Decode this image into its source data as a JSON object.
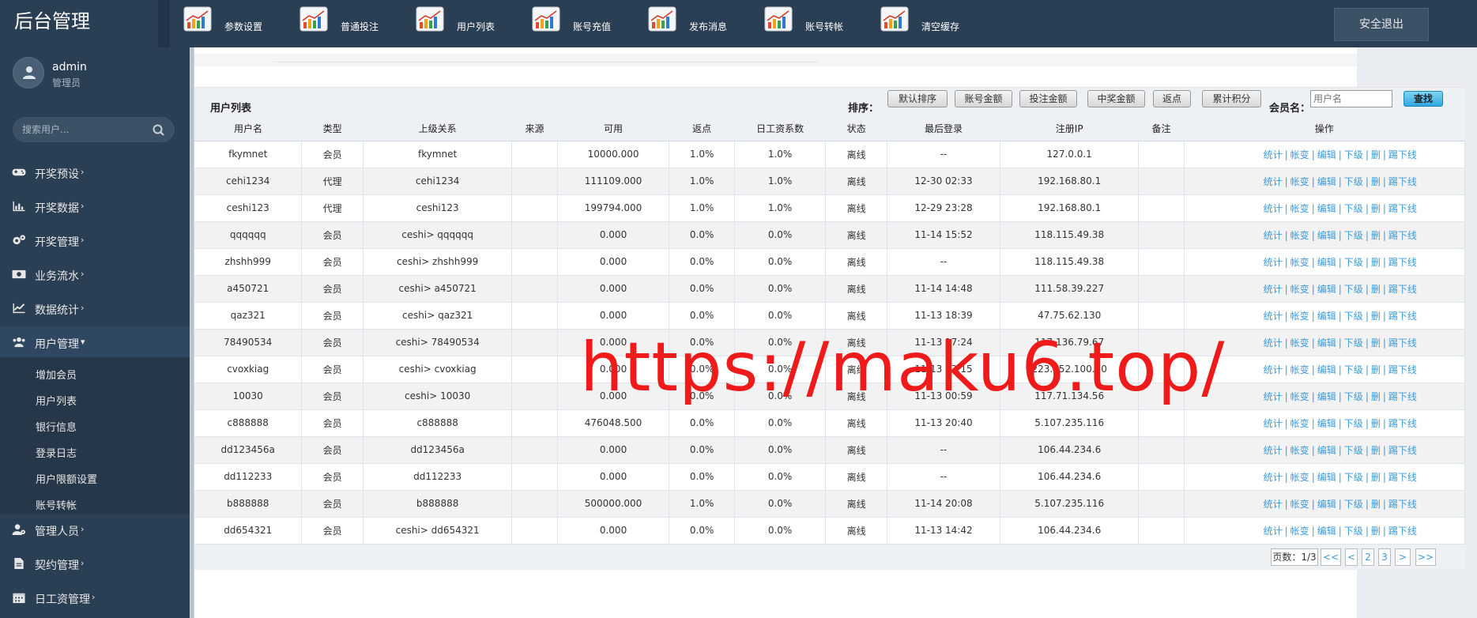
{
  "app": {
    "brand": "后台管理",
    "logout_label": "安全退出"
  },
  "topnav": [
    {
      "label": "参数设置",
      "icon": "chart-icon"
    },
    {
      "label": "普通投注",
      "icon": "chart-icon"
    },
    {
      "label": "用户列表",
      "icon": "chart-icon"
    },
    {
      "label": "账号充值",
      "icon": "chart-icon"
    },
    {
      "label": "发布消息",
      "icon": "chart-icon"
    },
    {
      "label": "账号转帐",
      "icon": "chart-icon"
    },
    {
      "label": "清空缓存",
      "icon": "chart-icon"
    }
  ],
  "user": {
    "name": "admin",
    "role": "管理员"
  },
  "sidebar": {
    "search_placeholder": "搜索用户...",
    "items": [
      {
        "label": "开奖预设",
        "icon": "gamepad-icon"
      },
      {
        "label": "开奖数据",
        "icon": "bar-chart-icon"
      },
      {
        "label": "开奖管理",
        "icon": "gears-icon"
      },
      {
        "label": "业务流水",
        "icon": "money-icon"
      },
      {
        "label": "数据统计",
        "icon": "line-chart-icon"
      },
      {
        "label": "用户管理",
        "icon": "users-icon"
      },
      {
        "label": "管理人员",
        "icon": "user-gear-icon"
      },
      {
        "label": "契约管理",
        "icon": "document-icon"
      },
      {
        "label": "日工资管理",
        "icon": "calendar-icon"
      }
    ],
    "submenu": [
      "增加会员",
      "用户列表",
      "银行信息",
      "登录日志",
      "用户限额设置",
      "账号转帐"
    ]
  },
  "panel": {
    "title": "用户列表",
    "sort_label": "排序：",
    "sort_buttons": [
      "默认排序",
      "账号金额",
      "投注金额",
      "中奖金额",
      "返点",
      "累计积分"
    ],
    "member_label": "会员名：",
    "member_placeholder": "用户名",
    "query_label": "查找"
  },
  "table": {
    "headers": [
      "用户名",
      "类型",
      "上级关系",
      "来源",
      "可用",
      "返点",
      "日工资系数",
      "状态",
      "最后登录",
      "注册IP",
      "备注",
      "操作"
    ],
    "actions": [
      "统计",
      "帐变",
      "编辑",
      "下级",
      "删",
      "踢下线"
    ],
    "rows": [
      [
        "fkymnet",
        "会员",
        "fkymnet",
        "",
        "10000.000",
        "1.0%",
        "1.0%",
        "离线",
        "--",
        "127.0.0.1",
        ""
      ],
      [
        "cehi1234",
        "代理",
        "cehi1234",
        "",
        "111109.000",
        "1.0%",
        "1.0%",
        "离线",
        "12-30 02:33",
        "192.168.80.1",
        ""
      ],
      [
        "ceshi123",
        "代理",
        "ceshi123",
        "",
        "199794.000",
        "1.0%",
        "1.0%",
        "离线",
        "12-29 23:28",
        "192.168.80.1",
        ""
      ],
      [
        "qqqqqq",
        "会员",
        "ceshi> qqqqqq",
        "",
        "0.000",
        "0.0%",
        "0.0%",
        "离线",
        "11-14 15:52",
        "118.115.49.38",
        ""
      ],
      [
        "zhshh999",
        "会员",
        "ceshi> zhshh999",
        "",
        "0.000",
        "0.0%",
        "0.0%",
        "离线",
        "--",
        "118.115.49.38",
        ""
      ],
      [
        "a450721",
        "会员",
        "ceshi> a450721",
        "",
        "0.000",
        "0.0%",
        "0.0%",
        "离线",
        "11-14 14:48",
        "111.58.39.227",
        ""
      ],
      [
        "qaz321",
        "会员",
        "ceshi> qaz321",
        "",
        "0.000",
        "0.0%",
        "0.0%",
        "离线",
        "11-13 18:39",
        "47.75.62.130",
        ""
      ],
      [
        "78490534",
        "会员",
        "ceshi> 78490534",
        "",
        "0.000",
        "0.0%",
        "0.0%",
        "离线",
        "11-13 17:24",
        "117.136.79.67",
        ""
      ],
      [
        "cvoxkiag",
        "会员",
        "ceshi> cvoxkiag",
        "",
        "0.000",
        "0.0%",
        "0.0%",
        "离线",
        "11-13 13:15",
        "223.152.100.50",
        ""
      ],
      [
        "10030",
        "会员",
        "ceshi> 10030",
        "",
        "0.000",
        "0.0%",
        "0.0%",
        "离线",
        "11-13 00:59",
        "117.71.134.56",
        ""
      ],
      [
        "c888888",
        "会员",
        "c888888",
        "",
        "476048.500",
        "0.0%",
        "0.0%",
        "离线",
        "11-13 20:40",
        "5.107.235.116",
        ""
      ],
      [
        "dd123456a",
        "会员",
        "dd123456a",
        "",
        "0.000",
        "0.0%",
        "0.0%",
        "离线",
        "--",
        "106.44.234.6",
        ""
      ],
      [
        "dd112233",
        "会员",
        "dd112233",
        "",
        "0.000",
        "0.0%",
        "0.0%",
        "离线",
        "--",
        "106.44.234.6",
        ""
      ],
      [
        "b888888",
        "会员",
        "b888888",
        "",
        "500000.000",
        "1.0%",
        "0.0%",
        "离线",
        "11-14 20:08",
        "5.107.235.116",
        ""
      ],
      [
        "dd654321",
        "会员",
        "ceshi> dd654321",
        "",
        "0.000",
        "0.0%",
        "0.0%",
        "离线",
        "11-13 14:42",
        "106.44.234.6",
        ""
      ]
    ]
  },
  "pagination": {
    "info": "页数：1/3",
    "buttons": [
      "<<",
      "<",
      "2",
      "3",
      ">",
      ">>"
    ]
  },
  "watermark": "https://maku6.top/"
}
